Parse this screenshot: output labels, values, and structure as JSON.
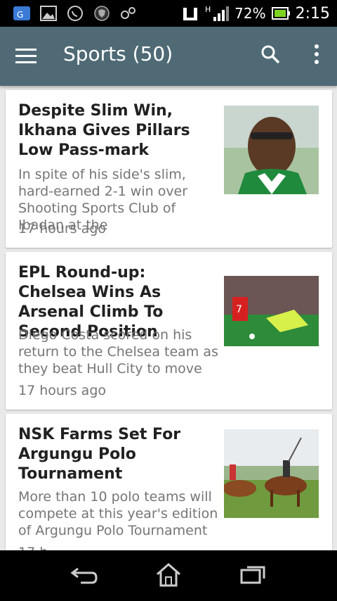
{
  "status": {
    "battery_percent": "72%",
    "time": "2:15",
    "network_label": "H"
  },
  "appbar": {
    "title": "Sports (50)"
  },
  "articles": [
    {
      "title": "Despite Slim Win, Ikhana Gives Pillars Low Pass-mark",
      "description": "In spite of his side's slim, hard-earned 2-1 win over Shooting Sports Club of Ibadan at the",
      "time": "17 hours ago"
    },
    {
      "title": "EPL Round-up: Chelsea Wins As Arsenal Climb To Second Position",
      "description": "Diego Costa scored on his return to the Chelsea team as they beat Hull City to move",
      "time": "17 hours ago"
    },
    {
      "title": "NSK Farms Set For Argungu Polo Tournament",
      "description": "More than 10 polo teams will compete at this year's edition of Argungu Polo Tournament",
      "time": "17 h"
    }
  ]
}
